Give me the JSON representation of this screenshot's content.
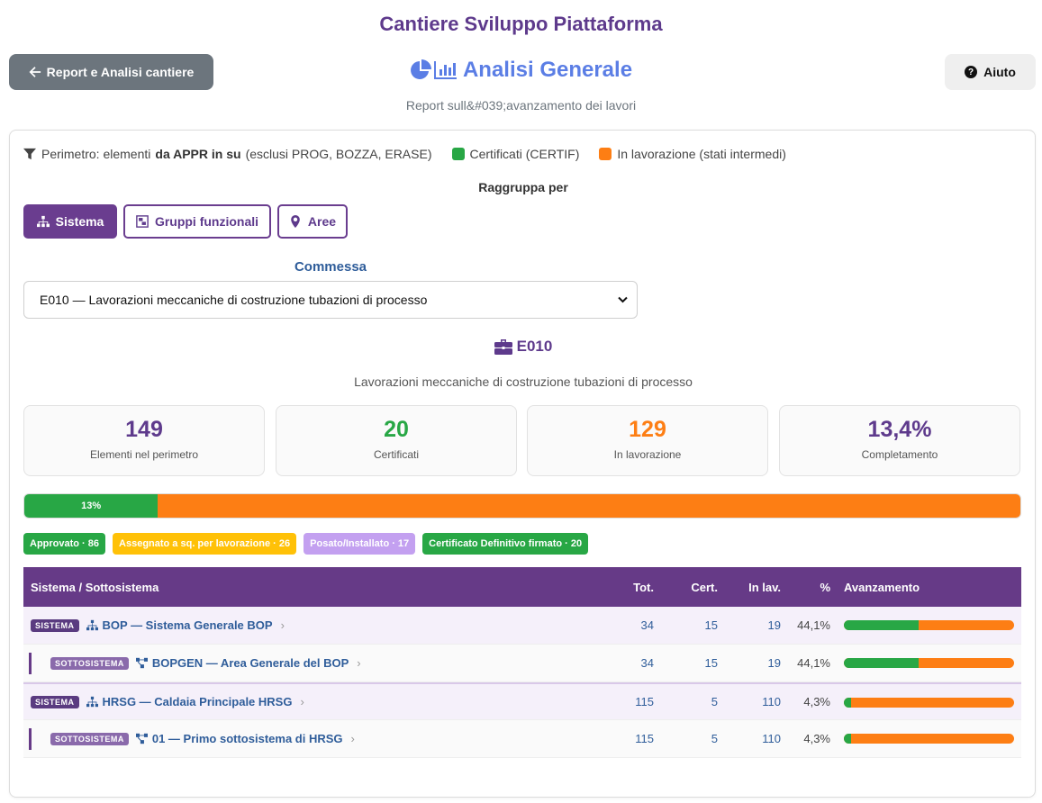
{
  "site_title": "Cantiere Sviluppo Piattaforma",
  "nav": {
    "back_label": "Report e Analisi cantiere",
    "help_label": "Aiuto"
  },
  "page": {
    "title": "Analisi Generale",
    "subtitle": "Report sull&#039;avanzamento dei lavori"
  },
  "legend": {
    "prefix": "Perimetro: elementi",
    "bold": "da APPR in su",
    "suffix": "(esclusi PROG, BOZZA, ERASE)",
    "certified": "Certificati (CERTIF)",
    "in_progress": "In lavorazione (stati intermedi)"
  },
  "colors": {
    "purple": "#663a87",
    "green": "#28a745",
    "orange": "#fd7e14",
    "blue": "#2f5d9a"
  },
  "grouping": {
    "title": "Raggruppa per",
    "options": [
      {
        "label": "Sistema",
        "icon": "sitemap-icon",
        "active": true
      },
      {
        "label": "Gruppi funzionali",
        "icon": "object-group-icon",
        "active": false
      },
      {
        "label": "Aree",
        "icon": "map-marker-icon",
        "active": false
      }
    ]
  },
  "commessa": {
    "label": "Commessa",
    "selected": "E010 — Lavorazioni meccaniche di costruzione tubazioni di processo"
  },
  "project": {
    "code": "E010",
    "description": "Lavorazioni meccaniche di costruzione tubazioni di processo"
  },
  "stats": [
    {
      "value": "149",
      "label": "Elementi nel perimetro",
      "color": "#5e3a8c"
    },
    {
      "value": "20",
      "label": "Certificati",
      "color": "#28a745"
    },
    {
      "value": "129",
      "label": "In lavorazione",
      "color": "#fd7e14"
    },
    {
      "value": "13,4%",
      "label": "Completamento",
      "color": "#5e3a8c"
    }
  ],
  "progress": {
    "label": "13%",
    "fraction": 0.134
  },
  "status_badges": [
    {
      "label": "Approvato · 86",
      "color": "#28a745",
      "text_color": "#ffffff"
    },
    {
      "label": "Assegnato a sq. per lavorazione · 26",
      "color": "#ffc107",
      "text_color": "#ffffff"
    },
    {
      "label": "Posato/Installato · 17",
      "color": "#c3a0f0",
      "text_color": "#ffffff"
    },
    {
      "label": "Certificato Definitivo firmato · 20",
      "color": "#28a745",
      "text_color": "#ffffff"
    }
  ],
  "table": {
    "headers": {
      "name": "Sistema / Sottosistema",
      "tot": "Tot.",
      "cert": "Cert.",
      "inlav": "In lav.",
      "pct": "%",
      "progress": "Avanzamento"
    },
    "rows": [
      {
        "kind": "sys",
        "tag": "SISTEMA",
        "icon": "sitemap-icon",
        "name": "BOP — Sistema Generale BOP",
        "tot": "34",
        "cert": "15",
        "inlav": "19",
        "pct": "44,1%",
        "fraction": 0.441
      },
      {
        "kind": "sub",
        "tag": "SOTTOSISTEMA",
        "icon": "project-diagram-icon",
        "name": "BOPGEN — Area Generale del BOP",
        "tot": "34",
        "cert": "15",
        "inlav": "19",
        "pct": "44,1%",
        "fraction": 0.441
      },
      {
        "kind": "sys",
        "tag": "SISTEMA",
        "icon": "sitemap-icon",
        "name": "HRSG — Caldaia Principale HRSG",
        "tot": "115",
        "cert": "5",
        "inlav": "110",
        "pct": "4,3%",
        "fraction": 0.043
      },
      {
        "kind": "sub",
        "tag": "SOTTOSISTEMA",
        "icon": "project-diagram-icon",
        "name": "01 — Primo sottosistema di HRSG",
        "tot": "115",
        "cert": "5",
        "inlav": "110",
        "pct": "4,3%",
        "fraction": 0.043
      }
    ]
  }
}
